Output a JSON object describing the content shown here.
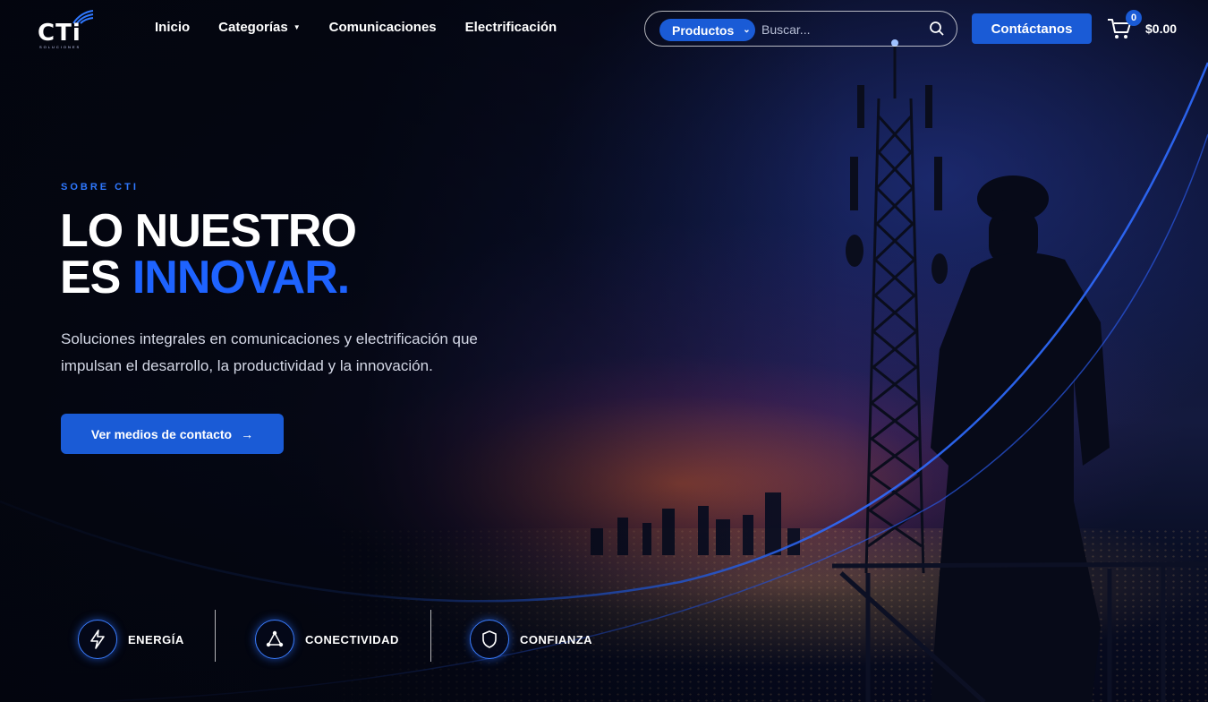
{
  "brand": {
    "logo_text": "CTi",
    "logo_sub": "SOLUCIONES"
  },
  "nav": {
    "items": [
      {
        "label": "Inicio"
      },
      {
        "label": "Categorías"
      },
      {
        "label": "Comunicaciones"
      },
      {
        "label": "Electrificación"
      }
    ]
  },
  "search": {
    "category": "Productos",
    "placeholder": "Buscar..."
  },
  "header": {
    "contact_label": "Contáctanos",
    "cart_count": "0",
    "cart_total": "$0.00"
  },
  "hero": {
    "eyebrow": "SOBRE CTI",
    "headline_line1": "LO NUESTRO",
    "headline_line2_prefix": "ES ",
    "headline_line2_accent": "INNOVAR.",
    "subtext": "Soluciones integrales en comunicaciones y electrificación que impulsan el desarrollo, la productividad y la innovación.",
    "cta_label": "Ver medios de contacto"
  },
  "features": [
    {
      "label": "ENERGÍA",
      "icon": "lightning-icon"
    },
    {
      "label": "CONECTIVIDAD",
      "icon": "network-icon"
    },
    {
      "label": "CONFIANZA",
      "icon": "shield-icon"
    }
  ],
  "colors": {
    "accent": "#1a5bd6",
    "accent_text": "#1e63ff"
  }
}
